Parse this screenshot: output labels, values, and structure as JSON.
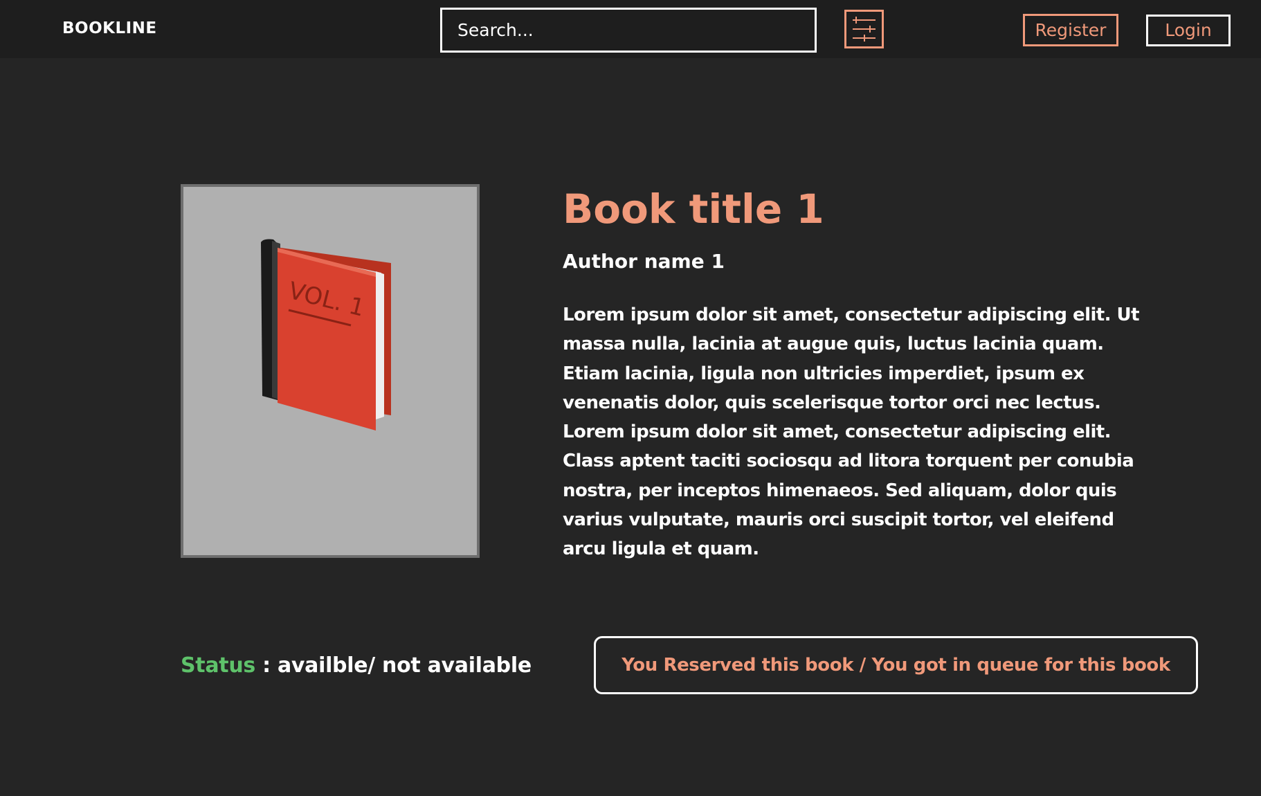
{
  "header": {
    "logo": "BOOKLINE",
    "search": {
      "placeholder": "Search...",
      "value": ""
    },
    "filter_icon": "sliders-icon",
    "register_label": "Register",
    "login_label": "Login"
  },
  "book": {
    "cover_icon": "book-cover-icon",
    "cover_text": "VOL. 1",
    "title": "Book title 1",
    "author": "Author name 1",
    "description": "Lorem ipsum dolor sit amet, consectetur adipiscing elit. Ut massa nulla, lacinia at augue quis, luctus lacinia quam. Etiam lacinia, ligula non ultricies imperdiet, ipsum ex venenatis dolor, quis scelerisque tortor orci nec lectus. Lorem ipsum dolor sit amet, consectetur adipiscing elit. Class aptent taciti sociosqu ad litora torquent per conubia nostra, per inceptos himenaeos. Sed aliquam, dolor quis varius vulputate, mauris orci suscipit tortor, vel eleifend arcu ligula et quam."
  },
  "status": {
    "label": "Status",
    "value": " : availble/ not available"
  },
  "reserve_button_label": "You Reserved this book / You got in queue for this book",
  "colors": {
    "background": "#252525",
    "header_background": "#1e1e1e",
    "accent": "#f0997a",
    "status_green": "#5ec26a",
    "cover_background": "#b0b0b0",
    "book_red": "#d9412f"
  }
}
